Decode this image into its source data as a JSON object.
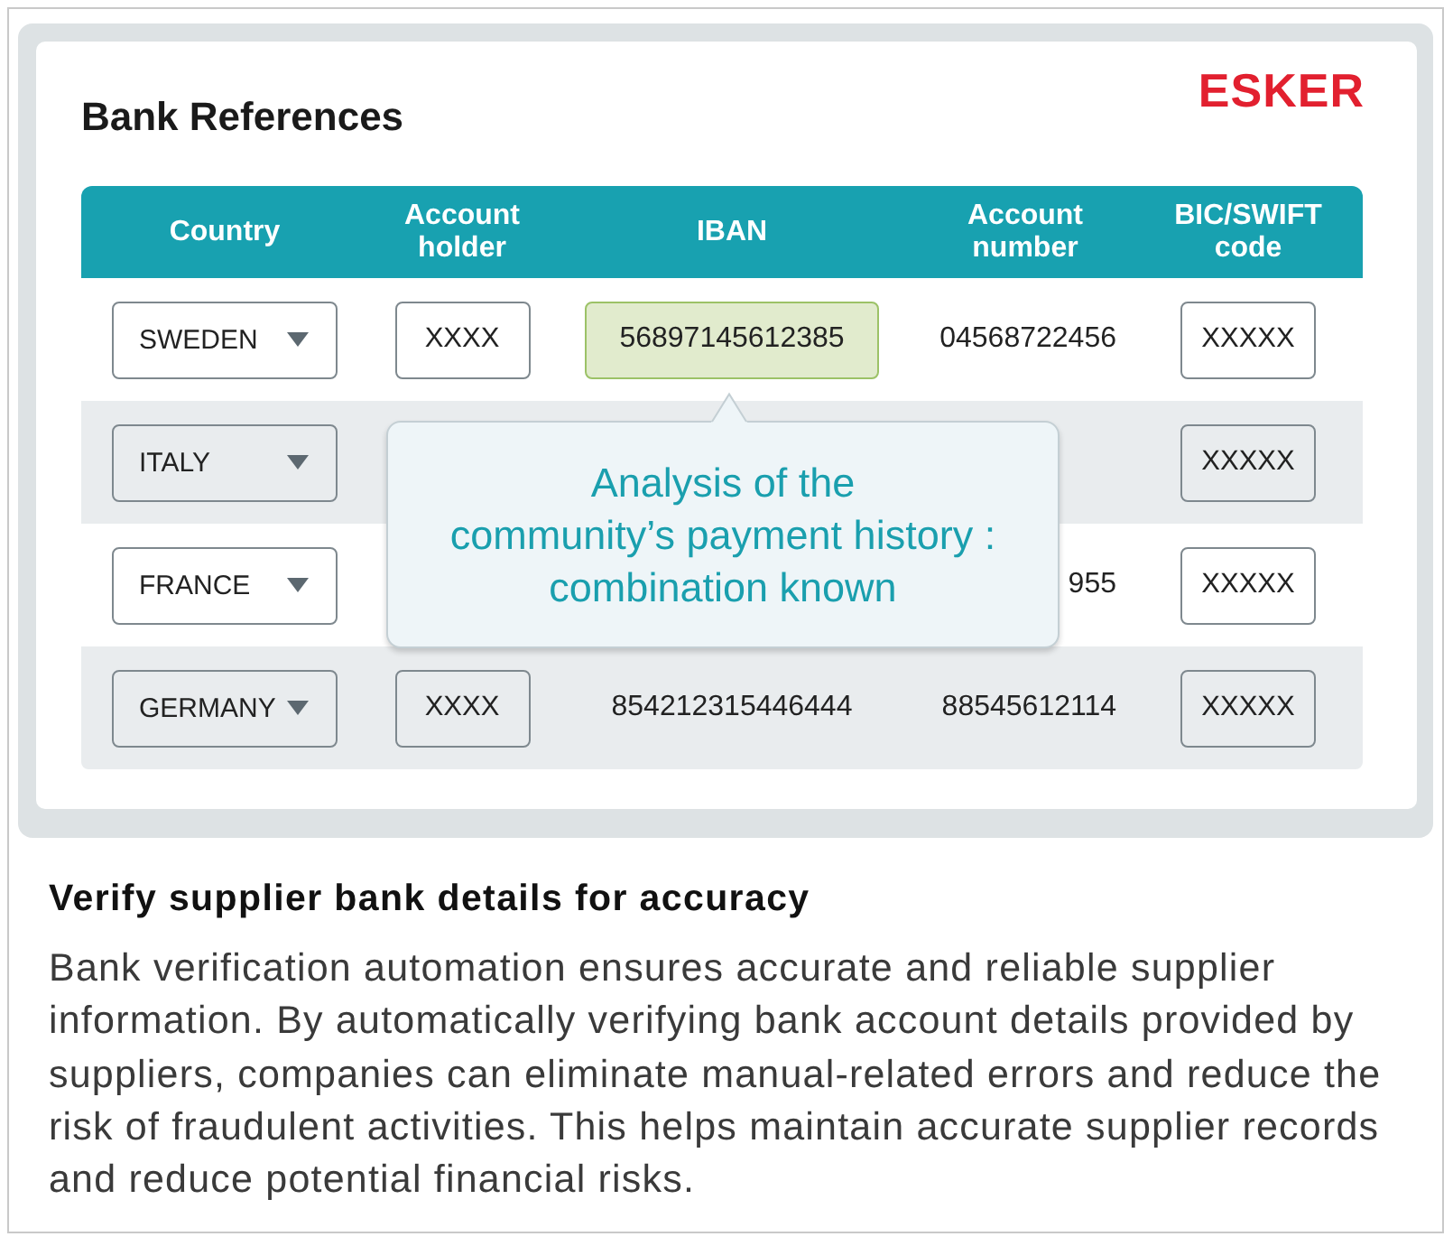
{
  "card": {
    "title": "Bank References",
    "logo": "ESKER"
  },
  "table": {
    "columns": [
      "Country",
      "Account holder",
      "IBAN",
      "Account number",
      "BIC/SWIFT code"
    ],
    "rows": [
      {
        "country": {
          "kind": "dropdown",
          "value": "SWEDEN"
        },
        "account_holder": {
          "kind": "field",
          "value": "XXXX",
          "highlighted": false
        },
        "iban": {
          "kind": "field",
          "value": "56897145612385",
          "highlighted": true
        },
        "account_number": {
          "kind": "text",
          "value": "04568722456"
        },
        "bic_swift_code": {
          "kind": "field",
          "value": "XXXXX",
          "highlighted": false
        }
      },
      {
        "country": {
          "kind": "dropdown",
          "value": "ITALY"
        },
        "bic_swift_code": {
          "kind": "field",
          "value": "XXXXX",
          "highlighted": false
        }
      },
      {
        "country": {
          "kind": "dropdown",
          "value": "FRANCE"
        },
        "account_number": {
          "kind": "text",
          "value": "955"
        },
        "bic_swift_code": {
          "kind": "field",
          "value": "XXXXX",
          "highlighted": false
        }
      },
      {
        "country": {
          "kind": "dropdown",
          "value": "GERMANY"
        },
        "account_holder": {
          "kind": "field",
          "value": "XXXX",
          "highlighted": false
        },
        "iban": {
          "kind": "text",
          "value": "854212315446444"
        },
        "account_number": {
          "kind": "text",
          "value": "88545612114"
        },
        "bic_swift_code": {
          "kind": "field",
          "value": "XXXXX",
          "highlighted": false
        }
      }
    ]
  },
  "tooltip": {
    "text": "Analysis of the\ncommunity’s payment history :\ncombination known"
  },
  "description": {
    "title": "Verify supplier bank details for accuracy",
    "body": "Bank verification automation ensures accurate and reliable supplier information. By automatically verifying bank account details provided by suppliers, companies can eliminate manual-related errors and reduce the risk of fraudulent activities. This helps maintain accurate supplier records and reduce potential financial risks."
  }
}
